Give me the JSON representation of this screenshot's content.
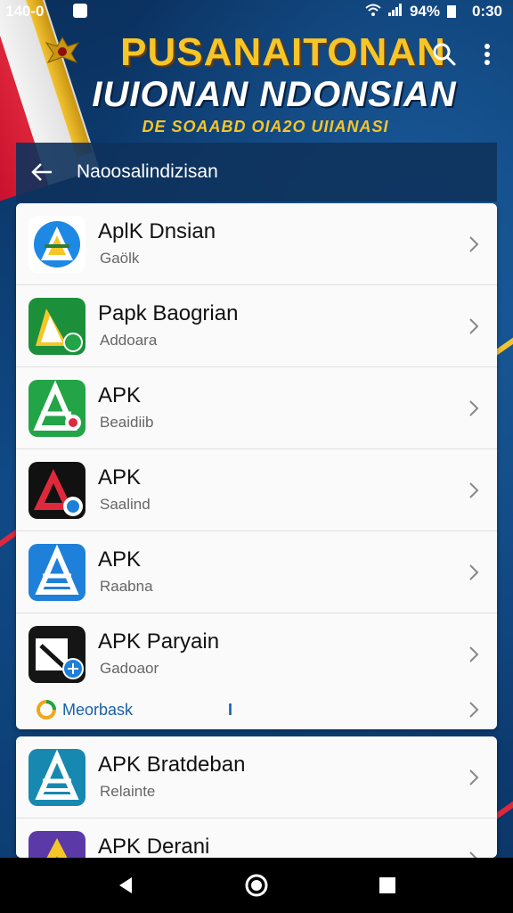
{
  "status_bar": {
    "left_text": "140-0",
    "battery": "94%",
    "time": "0:30"
  },
  "header": {
    "title_line1": "PUSANAITONAN",
    "title_line2": "IUIONAN NDONSIAN",
    "title_line3": "DE SOAABD OIA2O UIIANASI"
  },
  "nav": {
    "title": "Naoosalindizisan"
  },
  "apps": [
    {
      "name": "AplK Dnsian",
      "sub": "Gaölk",
      "icon": "apk-icon-blue-a",
      "color": "#1e88e5"
    },
    {
      "name": "Papk Baogrian",
      "sub": "Addoara",
      "icon": "apk-icon-green-a",
      "color": "#1b8f3a"
    },
    {
      "name": "APK",
      "sub": "Beaidiib",
      "icon": "apk-icon-green-tools",
      "color": "#22a447"
    },
    {
      "name": "APK",
      "sub": "Saalind",
      "icon": "apk-icon-red-a",
      "color": "#111111"
    },
    {
      "name": "APK",
      "sub": "Raabna",
      "icon": "apk-icon-blue-tools",
      "color": "#1e80d8"
    },
    {
      "name": "APK Paryain",
      "sub": "Gadoaor",
      "icon": "apk-icon-black-tools",
      "color": "#151515"
    }
  ],
  "feedback": {
    "label": "Meorbask",
    "extra": "I"
  },
  "apps2": [
    {
      "name": "APK Bratdeban",
      "sub": "Relainte",
      "icon": "apk-icon-teal-tools",
      "color": "#1789b0"
    },
    {
      "name": "APK Derani",
      "sub": "",
      "icon": "apk-icon-purple-a",
      "color": "#5b3aa8"
    }
  ],
  "colors": {
    "accent_gold": "#f6c628",
    "background_blue": "#0d3a6e",
    "link_blue": "#1a5fa8"
  }
}
